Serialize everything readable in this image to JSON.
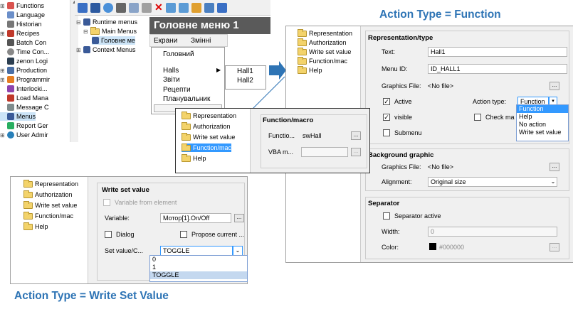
{
  "captions": {
    "function": "Action Type = Function",
    "write": "Action Type = Write Set Value"
  },
  "left_tree": {
    "items": [
      "Functions",
      "Language",
      "Historian",
      "Recipes",
      "Batch Con",
      "Time Con...",
      "zenon Logi",
      "Production",
      "Programmir",
      "Interlocki...",
      "Load Mana",
      "Message C",
      "Menus",
      "Report Ger",
      "User Admir"
    ]
  },
  "menu_tree": {
    "items": [
      "Runtime menus",
      "Main Menus",
      "Головне ме",
      "Context Menus"
    ]
  },
  "menu_editor": {
    "title": "Головне меню 1",
    "top_items": [
      "Екрани",
      "Змінні"
    ],
    "submenu": [
      "Головний",
      "Halls",
      "Звіти",
      "Рецепти",
      "Планувальник"
    ],
    "halls_sub": [
      "Hall1",
      "Hall2"
    ]
  },
  "prop_tree": {
    "items": [
      "Representation",
      "Authorization",
      "Write set value",
      "Function/mac",
      "Help"
    ]
  },
  "right_panel": {
    "representation_title": "Representation/type",
    "text_label": "Text:",
    "text_value": "Hall1",
    "menu_id_label": "Menu ID:",
    "menu_id_value": "ID_HALL1",
    "graphics_file_label": "Graphics File:",
    "graphics_file_value": "<No file>",
    "active_label": "Active",
    "visible_label": "visible",
    "submenu_label": "Submenu",
    "action_type_label": "Action type:",
    "action_type_value": "Function",
    "action_options": [
      "Function",
      "Help",
      "No action",
      "Write set value"
    ],
    "check_label": "Check ma",
    "bg_title": "Background graphic",
    "bg_graphics_file_label": "Graphics File:",
    "bg_graphics_file_value": "<No file>",
    "alignment_label": "Alignment:",
    "alignment_value": "Original size",
    "separator_title": "Separator",
    "separator_active_label": "Separator active",
    "width_label": "Width:",
    "width_value": "0",
    "color_label": "Color:",
    "color_value": "#000000",
    "dots": "..."
  },
  "function_panel": {
    "tree_items": [
      "Representation",
      "Authorization",
      "Write set value",
      "Function/mac",
      "Help"
    ],
    "title": "Function/macro",
    "function_label": "Functio...",
    "function_value": "swHall",
    "vba_label": "VBA m...",
    "dots": "..."
  },
  "write_panel": {
    "tree_items": [
      "Representation",
      "Authorization",
      "Write set value",
      "Function/mac",
      "Help"
    ],
    "title": "Write set value",
    "var_from_element": "Variable from element",
    "variable_label": "Variable:",
    "variable_value": "Мотор[1].On/Off",
    "dialog_label": "Dialog",
    "propose_label": "Propose current ...",
    "set_value_label": "Set value/C...",
    "set_value_value": "TOGGLE",
    "options": [
      "0",
      "1",
      "TOGGLE"
    ],
    "dots": "..."
  },
  "colors": {
    "caption": "#2e74b5",
    "menu_title_bg": "#5a5a5a",
    "arrow": "#2e74b5",
    "selected": "#3399ff"
  }
}
